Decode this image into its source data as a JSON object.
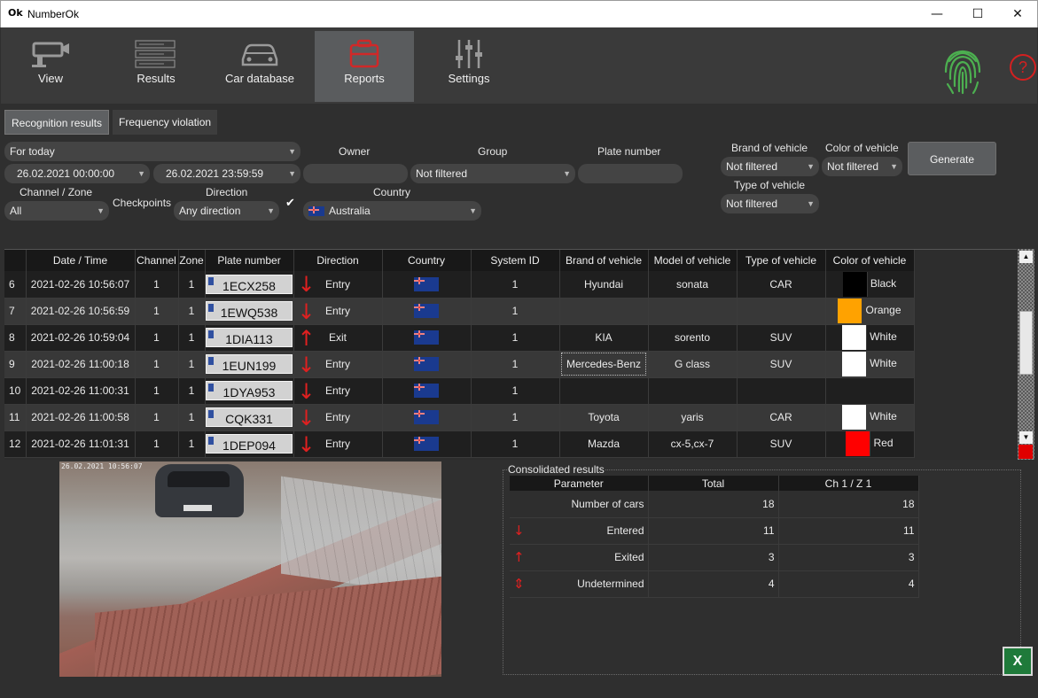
{
  "window": {
    "title": "NumberOk",
    "logo_text": "Ok",
    "minimize": "—",
    "maximize": "☐",
    "close": "✕"
  },
  "toolbar": {
    "items": [
      {
        "label": "View",
        "icon": "camera-icon"
      },
      {
        "label": "Results",
        "icon": "results-list-icon"
      },
      {
        "label": "Car database",
        "icon": "car-icon"
      },
      {
        "label": "Reports",
        "icon": "reports-icon",
        "active": true
      },
      {
        "label": "Settings",
        "icon": "sliders-icon"
      }
    ],
    "help": "?"
  },
  "subtabs": [
    {
      "label": "Recognition results",
      "active": true
    },
    {
      "label": "Frequency violation"
    }
  ],
  "filters": {
    "period": "For today",
    "date_from": "26.02.2021 00:00:00",
    "date_to": "26.02.2021 23:59:59",
    "owner_label": "Owner",
    "owner_value": "",
    "group_label": "Group",
    "group_value": "Not filtered",
    "plate_label": "Plate number",
    "plate_value": "",
    "brand_label": "Brand of vehicle",
    "brand_value": "Not filtered",
    "color_label": "Color of vehicle",
    "color_value": "Not filtered",
    "type_label": "Type of vehicle",
    "type_value": "Not filtered",
    "channel_label": "Channel / Zone",
    "channel_value": "All",
    "checkpoints_label": "Checkpoints",
    "direction_label": "Direction",
    "direction_value": "Any direction",
    "checkbox_mark": "✔",
    "country_label": "Country",
    "country_value": "Australia",
    "generate": "Generate"
  },
  "table": {
    "columns": [
      "",
      "Date / Time",
      "Channel",
      "Zone",
      "Plate number",
      "Direction",
      "Country",
      "System ID",
      "Brand of vehicle",
      "Model of vehicle",
      "Type of vehicle",
      "Color of vehicle"
    ],
    "rows": [
      {
        "n": "6",
        "dt": "2021-02-26 10:56:07",
        "ch": "1",
        "zone": "1",
        "plate": "1ECX258",
        "dir": "down",
        "dir_label": "Entry",
        "sid": "1",
        "brand": "Hyundai",
        "model": "sonata",
        "type": "CAR",
        "color": "Black",
        "swatch": "#000000"
      },
      {
        "n": "7",
        "dt": "2021-02-26 10:56:59",
        "ch": "1",
        "zone": "1",
        "plate": "1EWQ538",
        "dir": "down",
        "dir_label": "Entry",
        "sid": "1",
        "brand": "",
        "model": "",
        "type": "",
        "color": "Orange",
        "swatch": "#ffa200"
      },
      {
        "n": "8",
        "dt": "2021-02-26 10:59:04",
        "ch": "1",
        "zone": "1",
        "plate": "1DIA113",
        "dir": "up",
        "dir_label": "Exit",
        "sid": "1",
        "brand": "KIA",
        "model": "sorento",
        "type": "SUV",
        "color": "White",
        "swatch": "#ffffff"
      },
      {
        "n": "9",
        "dt": "2021-02-26 11:00:18",
        "ch": "1",
        "zone": "1",
        "plate": "1EUN199",
        "dir": "down",
        "dir_label": "Entry",
        "sid": "1",
        "brand": "Mercedes-Benz",
        "model": "G class",
        "type": "SUV",
        "color": "White",
        "swatch": "#ffffff"
      },
      {
        "n": "10",
        "dt": "2021-02-26 11:00:31",
        "ch": "1",
        "zone": "1",
        "plate": "1DYA953",
        "dir": "down",
        "dir_label": "Entry",
        "sid": "1",
        "brand": "",
        "model": "",
        "type": "",
        "color": "",
        "swatch": ""
      },
      {
        "n": "11",
        "dt": "2021-02-26 11:00:58",
        "ch": "1",
        "zone": "1",
        "plate": "CQK331",
        "dir": "down",
        "dir_label": "Entry",
        "sid": "1",
        "brand": "Toyota",
        "model": "yaris",
        "type": "CAR",
        "color": "White",
        "swatch": "#ffffff"
      },
      {
        "n": "12",
        "dt": "2021-02-26 11:01:31",
        "ch": "1",
        "zone": "1",
        "plate": "1DEP094",
        "dir": "down",
        "dir_label": "Entry",
        "sid": "1",
        "brand": "Mazda",
        "model": "cx-5,cx-7",
        "type": "SUV",
        "color": "Red",
        "swatch": "#ff0000"
      }
    ]
  },
  "camera": {
    "timestamp": "26.02.2021 10:56:07"
  },
  "consolidated": {
    "title": "Consolidated results",
    "columns": [
      "Parameter",
      "Total",
      "Ch 1 / Z 1"
    ],
    "rows": [
      {
        "icon": "",
        "param": "Number of cars",
        "total": "18",
        "ch": "18"
      },
      {
        "icon": "arrow-down",
        "param": "Entered",
        "total": "11",
        "ch": "11"
      },
      {
        "icon": "arrow-up",
        "param": "Exited",
        "total": "3",
        "ch": "3"
      },
      {
        "icon": "arrow-updown",
        "param": "Undetermined",
        "total": "4",
        "ch": "4"
      }
    ]
  },
  "colors": {
    "accent_red": "#e02020",
    "fingerprint": "#4caf50",
    "active_tab": "#5a5c5e"
  }
}
